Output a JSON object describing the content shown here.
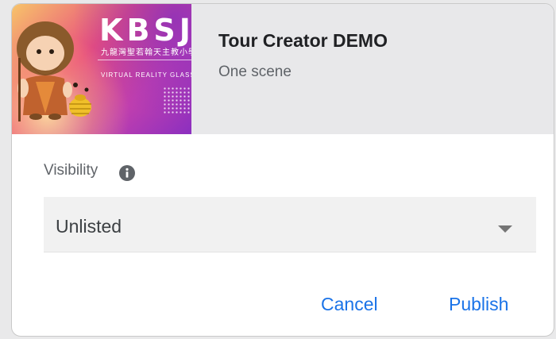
{
  "thumbnail": {
    "brand_text": "KBSJB",
    "subtitle_cn": "九龍灣聖若翰天主教小學",
    "subtitle_vr": "VIRTUAL REALITY GLASSES"
  },
  "tour": {
    "title": "Tour Creator DEMO",
    "scene_count": "One scene"
  },
  "visibility": {
    "label": "Visibility",
    "info_icon": "info-icon",
    "selected": "Unlisted",
    "dropdown_icon": "dropdown-arrow-icon"
  },
  "actions": {
    "cancel_label": "Cancel",
    "publish_label": "Publish"
  },
  "colors": {
    "accent": "#1a73e8",
    "header_bg": "#e8e8ea",
    "select_bg": "#f1f1f1"
  }
}
